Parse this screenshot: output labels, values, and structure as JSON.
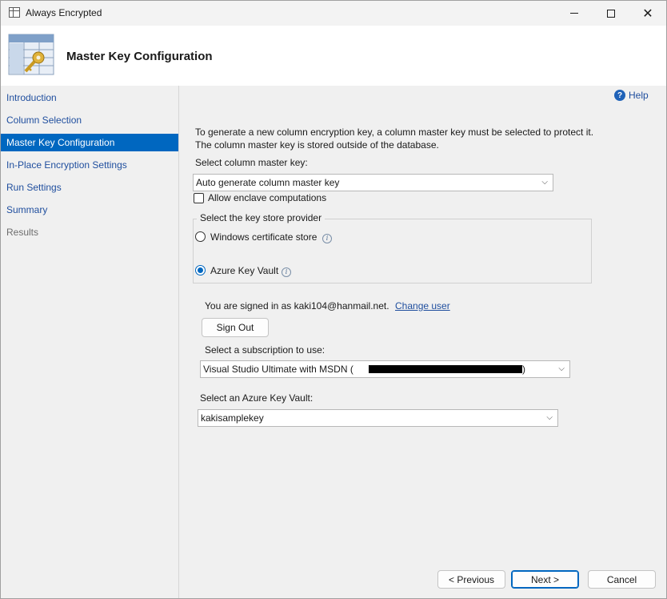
{
  "window": {
    "title": "Always Encrypted"
  },
  "header": {
    "title": "Master Key Configuration"
  },
  "sidebar": {
    "items": [
      {
        "label": "Introduction",
        "state": "link"
      },
      {
        "label": "Column Selection",
        "state": "link"
      },
      {
        "label": "Master Key Configuration",
        "state": "selected"
      },
      {
        "label": "In-Place Encryption Settings",
        "state": "link"
      },
      {
        "label": "Run Settings",
        "state": "link"
      },
      {
        "label": "Summary",
        "state": "link"
      },
      {
        "label": "Results",
        "state": "disabled"
      }
    ]
  },
  "main": {
    "help_label": "Help",
    "intro_text": "To generate a new column encryption key, a column master key must be selected to protect it.  The column master key is stored outside of the database.",
    "select_cmk_label": "Select column master key:",
    "cmk_value": "Auto generate column master key",
    "enclave_label": "Allow enclave computations",
    "enclave_checked": false,
    "provider_group_title": "Select the key store provider",
    "provider_windows_label": "Windows certificate store",
    "provider_azure_label": "Azure Key Vault",
    "provider_selected": "Azure Key Vault",
    "signed_in_text": "You are signed in as kaki104@hanmail.net.",
    "change_user_label": "Change user",
    "sign_out_label": "Sign Out",
    "subscription_label": "Select a subscription to use:",
    "subscription_value": "Visual Studio Ultimate with MSDN (",
    "subscription_suffix": ")",
    "keyvault_label": "Select an Azure Key Vault:",
    "keyvault_value": "kakisamplekey"
  },
  "footer": {
    "previous_label": "< Previous",
    "next_label": "Next >",
    "cancel_label": "Cancel"
  },
  "colors": {
    "accent": "#0067c0",
    "link": "#1f4e9e",
    "background": "#f0f0f0"
  }
}
